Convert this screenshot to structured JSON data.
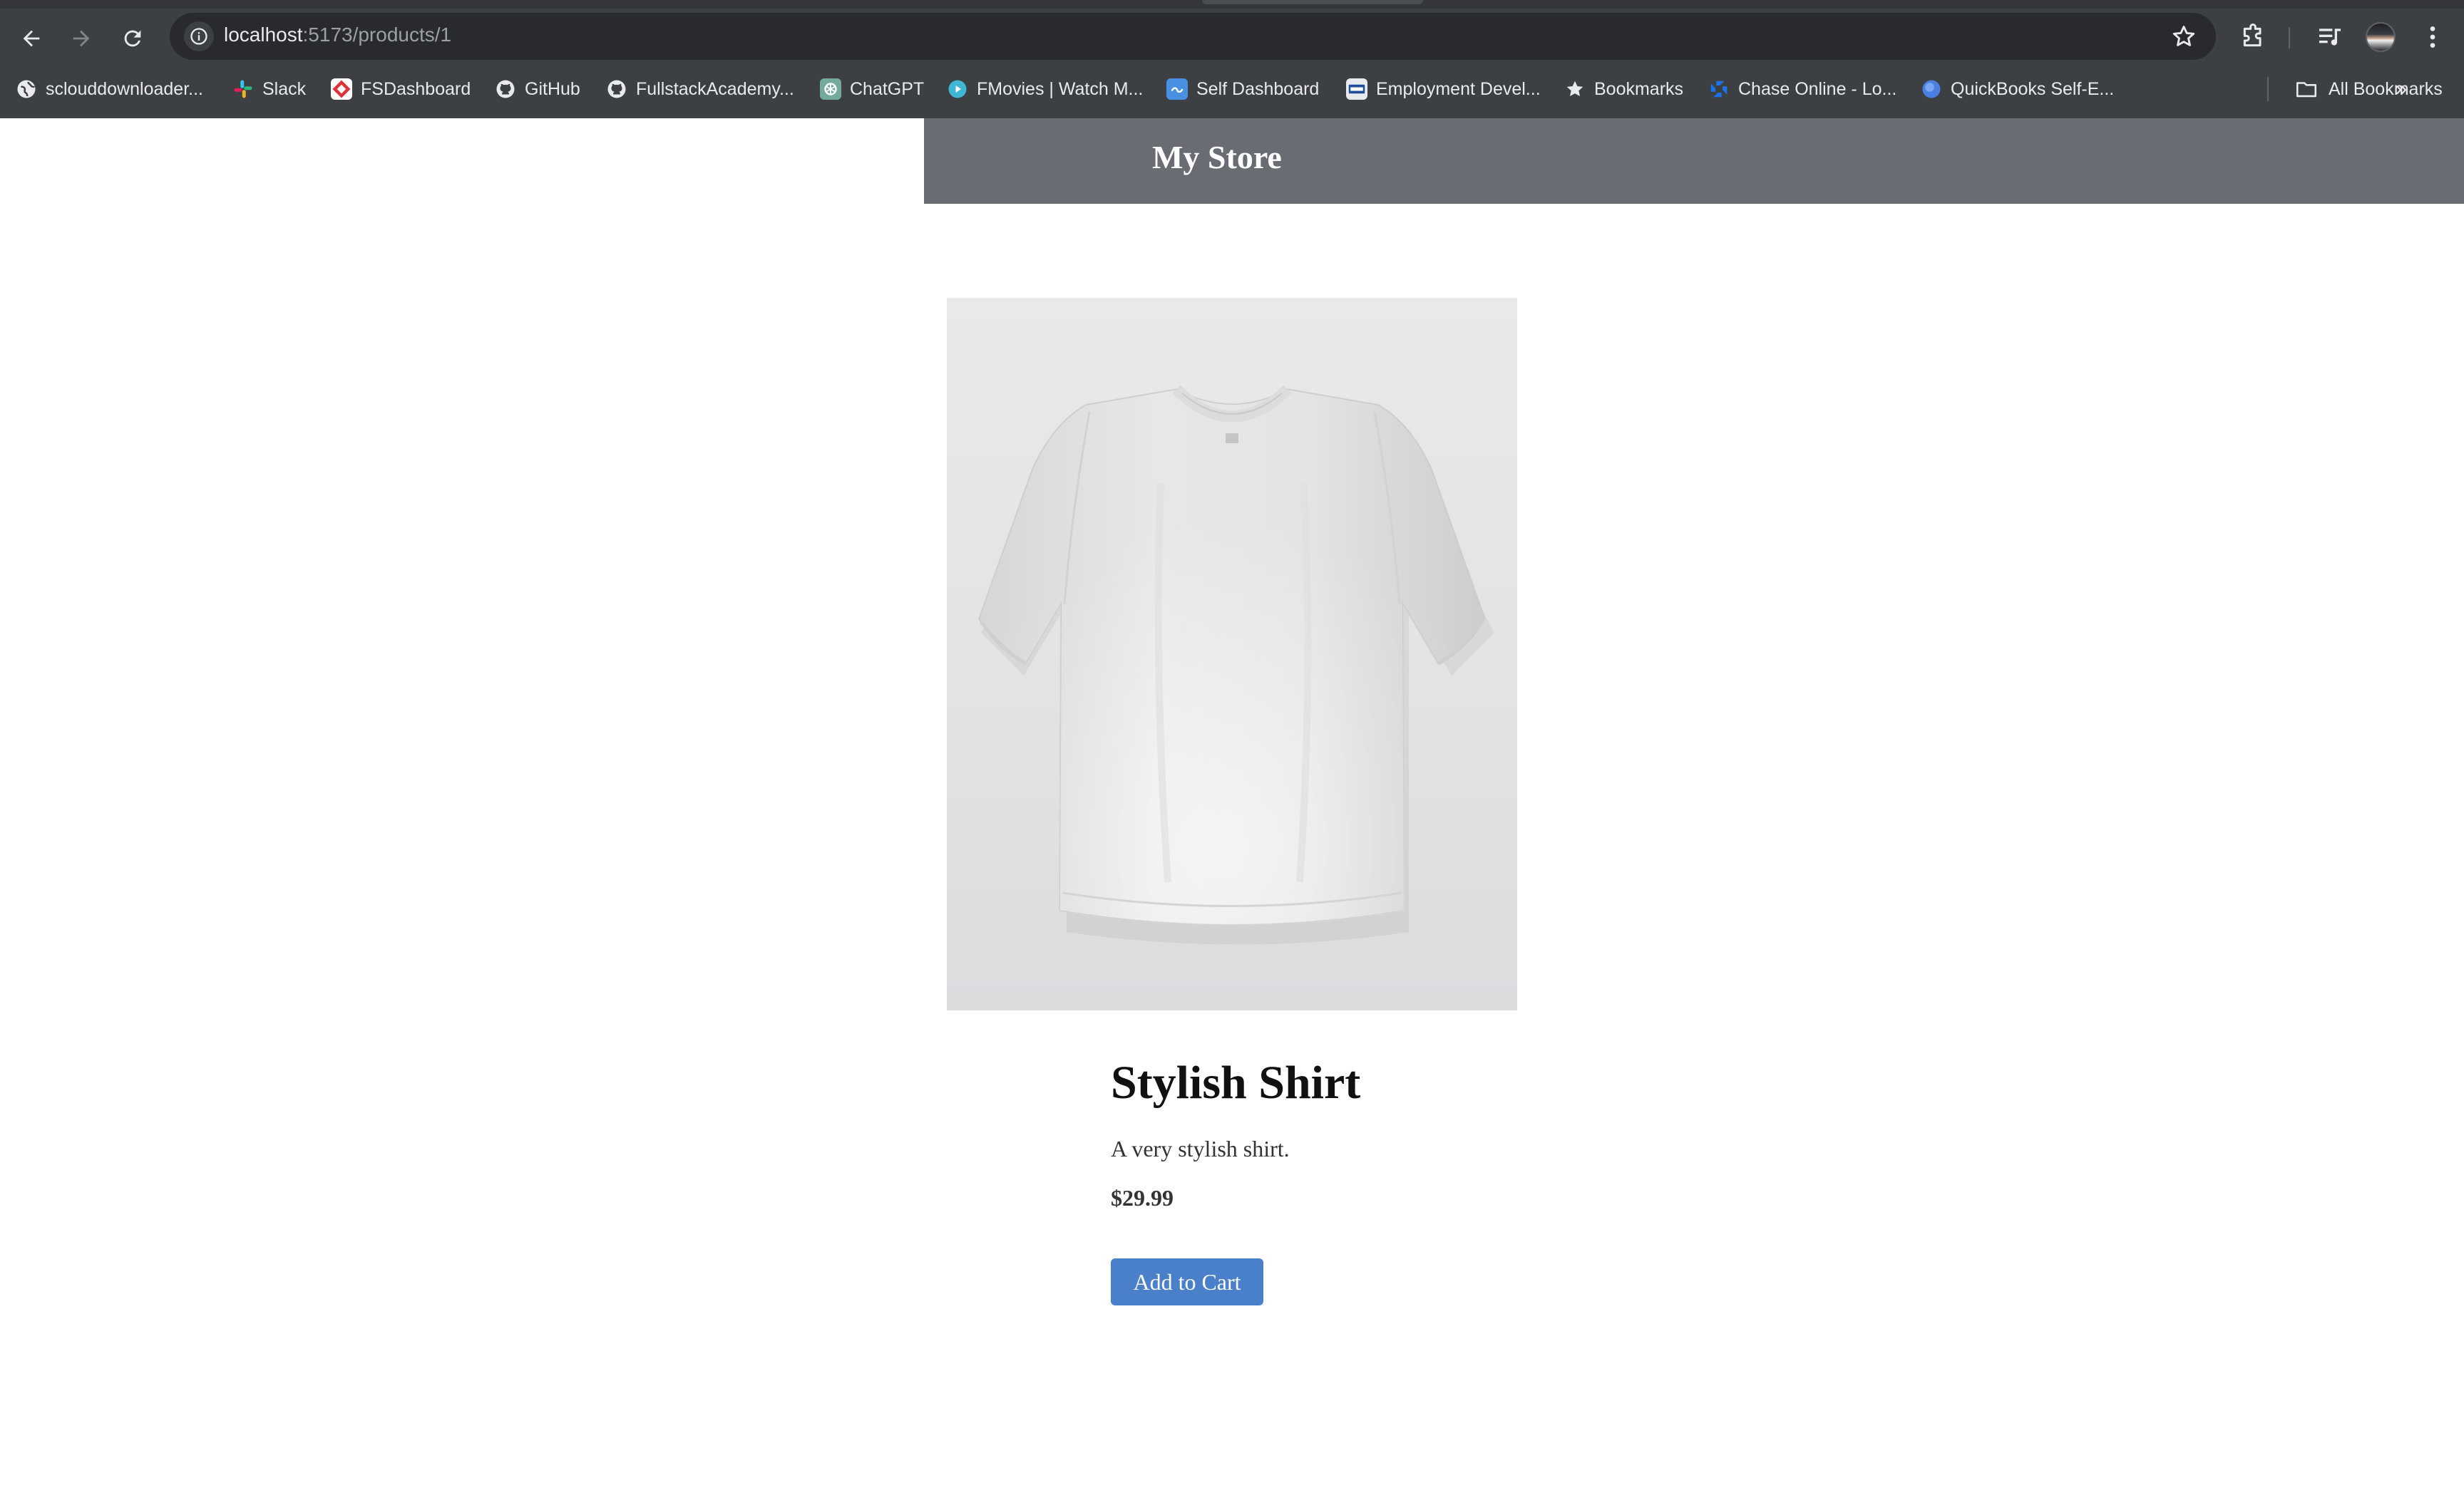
{
  "browser": {
    "url_host": "localhost",
    "url_path": ":5173/products/1",
    "bookmarks": [
      {
        "label": "sclouddownloader...",
        "icon": "globe-icon"
      },
      {
        "label": "Slack",
        "icon": "slack-icon"
      },
      {
        "label": "FSDashboard",
        "icon": "fsdashboard-icon"
      },
      {
        "label": "GitHub",
        "icon": "github-icon"
      },
      {
        "label": "FullstackAcademy...",
        "icon": "github-icon"
      },
      {
        "label": "ChatGPT",
        "icon": "chatgpt-icon"
      },
      {
        "label": "FMovies | Watch M...",
        "icon": "play-icon"
      },
      {
        "label": "Self Dashboard",
        "icon": "self-dashboard-icon"
      },
      {
        "label": "Employment Devel...",
        "icon": "edd-icon"
      },
      {
        "label": "Bookmarks",
        "icon": "star-icon"
      },
      {
        "label": "Chase Online - Lo...",
        "icon": "chase-icon"
      },
      {
        "label": "QuickBooks Self-E...",
        "icon": "quickbooks-icon"
      }
    ],
    "all_bookmarks_label": "All Bookmarks"
  },
  "store": {
    "title": "My Store"
  },
  "product": {
    "name": "Stylish Shirt",
    "description": "A very stylish shirt.",
    "price": "$29.99",
    "add_to_cart_label": "Add to Cart",
    "image_subject": "white-tshirt"
  },
  "colors": {
    "header_bg": "#696c73",
    "button_bg": "#4a7fc9",
    "chrome_bg": "#3c4043"
  }
}
